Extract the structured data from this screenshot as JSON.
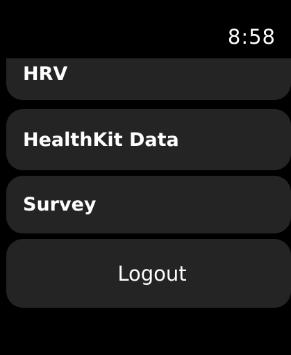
{
  "status_bar": {
    "time": "8:58"
  },
  "menu": {
    "items": [
      {
        "label": "HRV"
      },
      {
        "label": "HealthKit Data"
      },
      {
        "label": "Survey"
      }
    ],
    "logout_label": "Logout"
  },
  "colors": {
    "background": "#000000",
    "row_background": "#242424",
    "text": "#ffffff"
  }
}
